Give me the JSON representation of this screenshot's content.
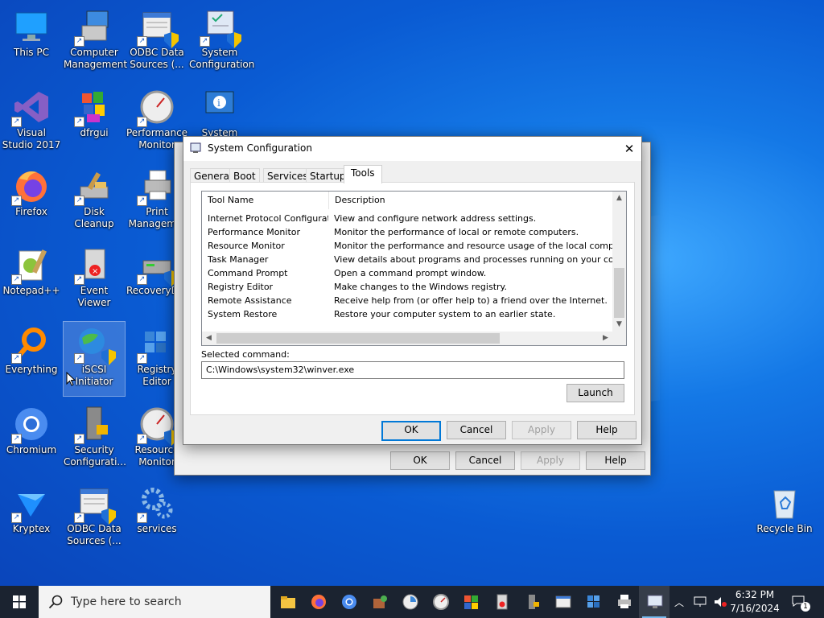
{
  "desktop": {
    "icons": [
      {
        "label": "This PC"
      },
      {
        "label": "Computer Management"
      },
      {
        "label": "ODBC Data Sources (..."
      },
      {
        "label": "System Configuration"
      },
      {
        "label": "Visual Studio 2017"
      },
      {
        "label": "dfrgui"
      },
      {
        "label": "Performance Monitor"
      },
      {
        "label": "System"
      },
      {
        "label": "Firefox"
      },
      {
        "label": "Disk Cleanup"
      },
      {
        "label": "Print Managem..."
      },
      {
        "label": "Notepad++"
      },
      {
        "label": "Event Viewer"
      },
      {
        "label": "RecoveryD..."
      },
      {
        "label": "Everything"
      },
      {
        "label": "iSCSI Initiator"
      },
      {
        "label": "Registry Editor"
      },
      {
        "label": "Chromium"
      },
      {
        "label": "Security Configurati..."
      },
      {
        "label": "Resource Monitor"
      },
      {
        "label": "Kryptex"
      },
      {
        "label": "ODBC Data Sources (..."
      },
      {
        "label": "services"
      },
      {
        "label": "Recycle Bin"
      }
    ]
  },
  "back_window": {
    "ok": "OK",
    "cancel": "Cancel",
    "apply": "Apply",
    "help": "Help"
  },
  "dialog": {
    "title": "System Configuration",
    "close": "✕",
    "tabs": [
      "General",
      "Boot",
      "Services",
      "Startup",
      "Tools"
    ],
    "active_tab": "Tools",
    "columns": [
      "Tool Name",
      "Description"
    ],
    "rows": [
      {
        "name": "Internet Protocol Configurat...",
        "desc": "View and configure network address settings."
      },
      {
        "name": "Performance Monitor",
        "desc": "Monitor the performance of local or remote computers."
      },
      {
        "name": "Resource Monitor",
        "desc": "Monitor the performance and resource usage of the local computer."
      },
      {
        "name": "Task Manager",
        "desc": "View details about programs and processes running on your computer."
      },
      {
        "name": "Command Prompt",
        "desc": "Open a command prompt window."
      },
      {
        "name": "Registry Editor",
        "desc": "Make changes to the Windows registry."
      },
      {
        "name": "Remote Assistance",
        "desc": "Receive help from (or offer help to) a friend over the Internet."
      },
      {
        "name": "System Restore",
        "desc": "Restore your computer system to an earlier state."
      }
    ],
    "selected_label": "Selected command:",
    "selected_value": "C:\\Windows\\system32\\winver.exe",
    "launch": "Launch",
    "ok": "OK",
    "cancel": "Cancel",
    "apply": "Apply",
    "help": "Help"
  },
  "taskbar": {
    "search_placeholder": "Type here to search",
    "time": "6:32 PM",
    "date": "7/16/2024",
    "notification_count": "1"
  },
  "colors": {
    "accent": "#0078d7",
    "taskbar": "#1b2330",
    "desktop": "#0a5bd3"
  }
}
